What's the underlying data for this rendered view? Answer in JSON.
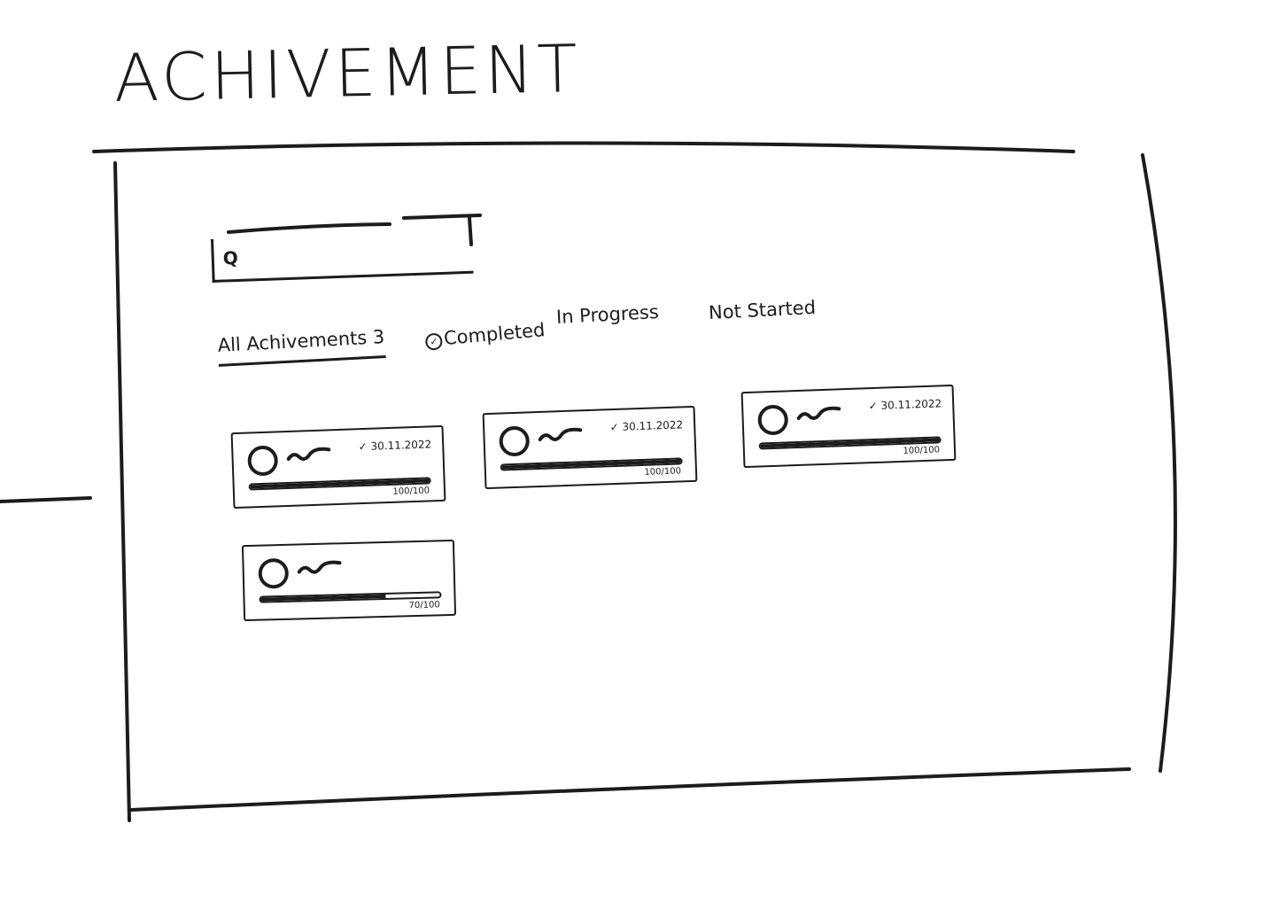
{
  "page": {
    "title": "ACHIVEMENT"
  },
  "search": {
    "icon": "search-icon",
    "value": "",
    "placeholder": ""
  },
  "tabs": [
    {
      "label": "All Achivements 3",
      "active": true,
      "icon": null
    },
    {
      "label": "Completed",
      "active": false,
      "icon": "check-circle-icon"
    },
    {
      "label": "In Progress",
      "active": false,
      "icon": null
    },
    {
      "label": "Not Started",
      "active": false,
      "icon": null
    }
  ],
  "achievements": [
    {
      "icon": "circle-badge-icon",
      "completed": true,
      "date": "30.11.2022",
      "progress_text": "100/100",
      "progress": 1.0
    },
    {
      "icon": "circle-badge-icon",
      "completed": true,
      "date": "30.11.2022",
      "progress_text": "100/100",
      "progress": 1.0
    },
    {
      "icon": "circle-badge-icon",
      "completed": true,
      "date": "30.11.2022",
      "progress_text": "100/100",
      "progress": 1.0
    },
    {
      "icon": "circle-badge-icon",
      "completed": false,
      "date": "",
      "progress_text": "70/100",
      "progress": 0.7
    }
  ],
  "colors": {
    "ink": "#1c1c1c",
    "background": "#ffffff"
  }
}
